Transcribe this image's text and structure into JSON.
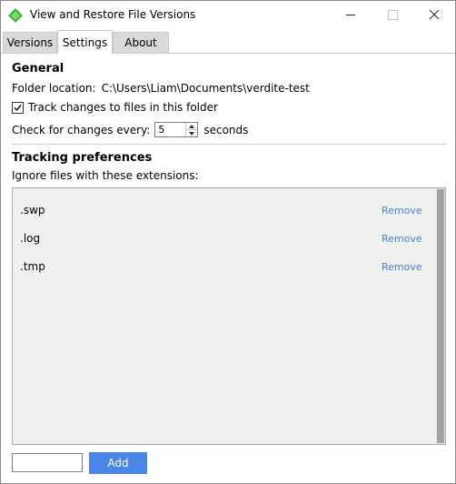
{
  "window": {
    "title": "View and Restore File Versions",
    "accent_color": "#3db33d"
  },
  "tabs": [
    {
      "label": "Versions",
      "active": false
    },
    {
      "label": "Settings",
      "active": true
    },
    {
      "label": "About",
      "active": false
    }
  ],
  "general": {
    "heading": "General",
    "folder_label": "Folder location:",
    "folder_path": "C:\\Users\\Liam\\Documents\\verdite-test",
    "track_label": "Track changes to files in this folder",
    "track_checked": true,
    "interval_label": "Check for changes every:",
    "interval_value": "5",
    "interval_unit": "seconds"
  },
  "tracking": {
    "heading": "Tracking preferences",
    "ignore_label": "Ignore files with these extensions:",
    "extensions": [
      {
        "ext": ".swp",
        "action": "Remove"
      },
      {
        "ext": ".log",
        "action": "Remove"
      },
      {
        "ext": ".tmp",
        "action": "Remove"
      }
    ],
    "link_color": "#4a7fd0"
  },
  "footer": {
    "input_value": "",
    "add_label": "Add",
    "add_color": "#4a86e8"
  }
}
